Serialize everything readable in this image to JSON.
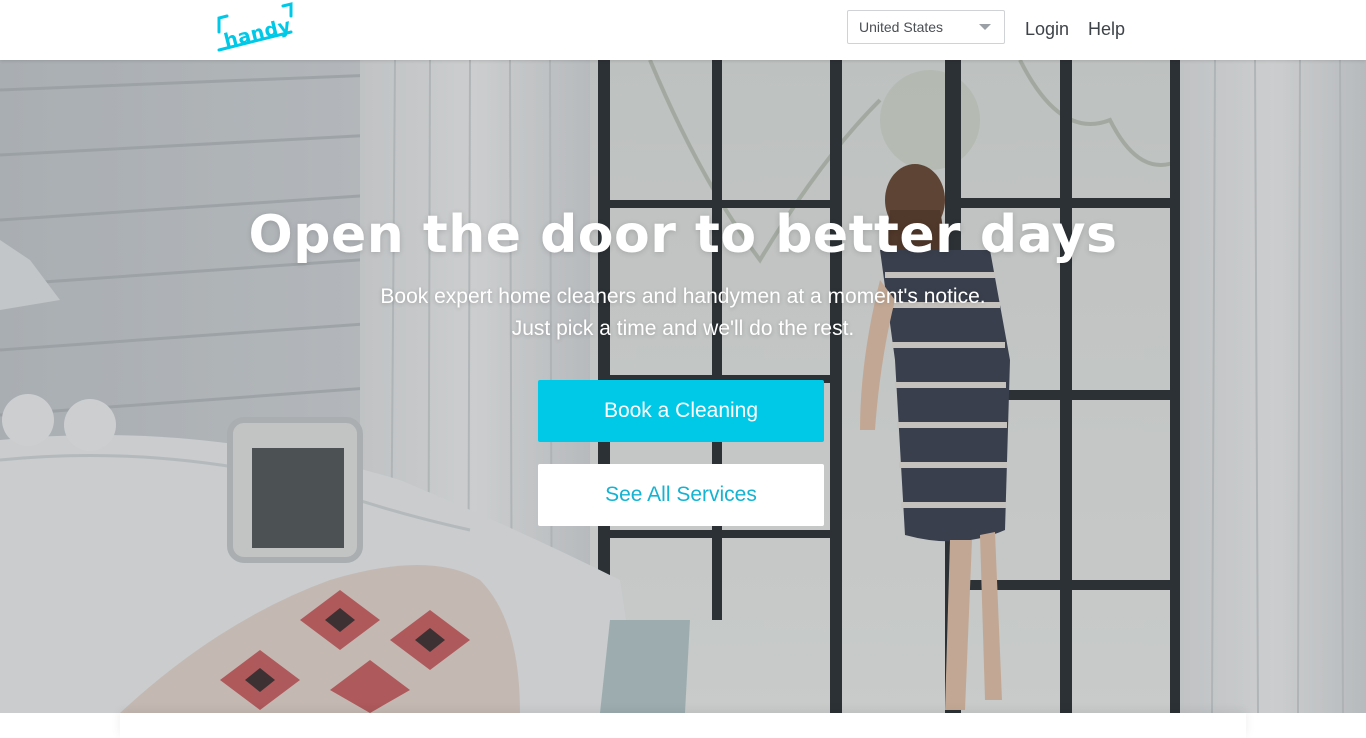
{
  "header": {
    "logo_text": "handy",
    "country_select": {
      "selected": "United States"
    },
    "nav": {
      "login": "Login",
      "help": "Help"
    }
  },
  "hero": {
    "title": "Open the door to better days",
    "subtitle_line1": "Book expert home cleaners and handymen at a moment's notice.",
    "subtitle_line2": "Just pick a time and we'll do the rest.",
    "primary_button": "Book a Cleaning",
    "secondary_button": "See All Services"
  },
  "colors": {
    "brand_cyan": "#00c9e8",
    "secondary_button_text": "#14b3d1",
    "header_background": "#ffffff"
  },
  "icons": {
    "logo": "handy-logo-icon",
    "dropdown": "caret-down-icon"
  }
}
